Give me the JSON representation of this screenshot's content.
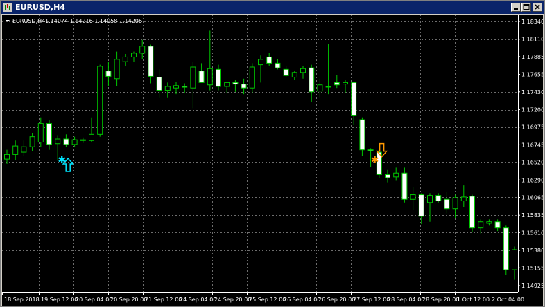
{
  "window": {
    "title": "EURUSD,H4"
  },
  "chart_header": {
    "symbol": "EURUSD,H4",
    "ohlc": "1.14074 1.14216 1.14058 1.14206"
  },
  "chart_data": {
    "type": "candlestick",
    "symbol": "EURUSD",
    "timeframe": "H4",
    "y_ticks": [
      "1.18340",
      "1.18110",
      "1.17885",
      "1.17655",
      "1.17430",
      "1.17200",
      "1.16975",
      "1.16745",
      "1.16520",
      "1.16290",
      "1.16065",
      "1.15835",
      "1.15610",
      "1.15380",
      "1.15155",
      "1.14925"
    ],
    "x_ticks": [
      "18 Sep 2018",
      "19 Sep 12:00",
      "20 Sep 04:00",
      "20 Sep 20:00",
      "21 Sep 12:00",
      "24 Sep 04:00",
      "24 Sep 20:00",
      "25 Sep 12:00",
      "26 Sep 04:00",
      "26 Sep 20:00",
      "27 Sep 12:00",
      "28 Sep 04:00",
      "28 Sep 20:00",
      "1 Oct 12:00",
      "2 Oct 04:00"
    ],
    "ylim": [
      1.14925,
      1.1839
    ],
    "grid": true,
    "colors": {
      "background": "#000000",
      "bull": "#000000",
      "bear": "#ffffff",
      "wick": "#00c800",
      "grid": "#c8c8c8",
      "axis_text": "#ffffff",
      "buy_marker": "#00e5ff",
      "sell_marker": "#ff9900"
    },
    "candles": [
      {
        "o": 1.1656,
        "h": 1.1668,
        "l": 1.165,
        "c": 1.1662
      },
      {
        "o": 1.1662,
        "h": 1.168,
        "l": 1.1655,
        "c": 1.1673
      },
      {
        "o": 1.1665,
        "h": 1.168,
        "l": 1.166,
        "c": 1.1672
      },
      {
        "o": 1.1672,
        "h": 1.169,
        "l": 1.1666,
        "c": 1.1685
      },
      {
        "o": 1.1678,
        "h": 1.171,
        "l": 1.1672,
        "c": 1.1702
      },
      {
        "o": 1.1702,
        "h": 1.1706,
        "l": 1.1668,
        "c": 1.1675
      },
      {
        "o": 1.1676,
        "h": 1.1687,
        "l": 1.1654,
        "c": 1.1682
      },
      {
        "o": 1.1682,
        "h": 1.1688,
        "l": 1.1672,
        "c": 1.1675
      },
      {
        "o": 1.1675,
        "h": 1.1685,
        "l": 1.1672,
        "c": 1.1681
      },
      {
        "o": 1.168,
        "h": 1.1684,
        "l": 1.1677,
        "c": 1.1681
      },
      {
        "o": 1.168,
        "h": 1.171,
        "l": 1.1678,
        "c": 1.1688
      },
      {
        "o": 1.1688,
        "h": 1.1778,
        "l": 1.1685,
        "c": 1.1776
      },
      {
        "o": 1.177,
        "h": 1.1782,
        "l": 1.175,
        "c": 1.1763
      },
      {
        "o": 1.176,
        "h": 1.1795,
        "l": 1.175,
        "c": 1.1785
      },
      {
        "o": 1.1782,
        "h": 1.1792,
        "l": 1.1776,
        "c": 1.1788
      },
      {
        "o": 1.1788,
        "h": 1.1795,
        "l": 1.1782,
        "c": 1.1793
      },
      {
        "o": 1.1793,
        "h": 1.181,
        "l": 1.1785,
        "c": 1.1802
      },
      {
        "o": 1.1802,
        "h": 1.1804,
        "l": 1.1754,
        "c": 1.1763
      },
      {
        "o": 1.1762,
        "h": 1.1772,
        "l": 1.1735,
        "c": 1.1745
      },
      {
        "o": 1.1745,
        "h": 1.1755,
        "l": 1.1735,
        "c": 1.175
      },
      {
        "o": 1.1748,
        "h": 1.1756,
        "l": 1.174,
        "c": 1.1751
      },
      {
        "o": 1.175,
        "h": 1.1754,
        "l": 1.1742,
        "c": 1.1749
      },
      {
        "o": 1.1748,
        "h": 1.1782,
        "l": 1.1722,
        "c": 1.1775
      },
      {
        "o": 1.177,
        "h": 1.178,
        "l": 1.1755,
        "c": 1.1755
      },
      {
        "o": 1.1752,
        "h": 1.1822,
        "l": 1.1745,
        "c": 1.1773
      },
      {
        "o": 1.1772,
        "h": 1.1778,
        "l": 1.1745,
        "c": 1.175
      },
      {
        "o": 1.175,
        "h": 1.1756,
        "l": 1.1742,
        "c": 1.1755
      },
      {
        "o": 1.1755,
        "h": 1.1758,
        "l": 1.1743,
        "c": 1.1753
      },
      {
        "o": 1.1753,
        "h": 1.176,
        "l": 1.174,
        "c": 1.1748
      },
      {
        "o": 1.1748,
        "h": 1.178,
        "l": 1.1742,
        "c": 1.1775
      },
      {
        "o": 1.1778,
        "h": 1.179,
        "l": 1.1755,
        "c": 1.1785
      },
      {
        "o": 1.1788,
        "h": 1.1793,
        "l": 1.1776,
        "c": 1.178
      },
      {
        "o": 1.178,
        "h": 1.1785,
        "l": 1.1772,
        "c": 1.1774
      },
      {
        "o": 1.1772,
        "h": 1.1776,
        "l": 1.1762,
        "c": 1.1764
      },
      {
        "o": 1.1762,
        "h": 1.177,
        "l": 1.1758,
        "c": 1.1768
      },
      {
        "o": 1.1768,
        "h": 1.1776,
        "l": 1.176,
        "c": 1.1773
      },
      {
        "o": 1.1774,
        "h": 1.1778,
        "l": 1.173,
        "c": 1.1743
      },
      {
        "o": 1.1744,
        "h": 1.176,
        "l": 1.1735,
        "c": 1.1752
      },
      {
        "o": 1.175,
        "h": 1.1805,
        "l": 1.174,
        "c": 1.175
      },
      {
        "o": 1.1755,
        "h": 1.1765,
        "l": 1.1748,
        "c": 1.1752
      },
      {
        "o": 1.1753,
        "h": 1.1758,
        "l": 1.1742,
        "c": 1.1755
      },
      {
        "o": 1.1755,
        "h": 1.1755,
        "l": 1.17,
        "c": 1.1712
      },
      {
        "o": 1.1707,
        "h": 1.171,
        "l": 1.166,
        "c": 1.1668
      },
      {
        "o": 1.1668,
        "h": 1.167,
        "l": 1.1646,
        "c": 1.1667
      },
      {
        "o": 1.1665,
        "h": 1.167,
        "l": 1.1632,
        "c": 1.1636
      },
      {
        "o": 1.1636,
        "h": 1.1642,
        "l": 1.1626,
        "c": 1.1632
      },
      {
        "o": 1.1633,
        "h": 1.1645,
        "l": 1.1628,
        "c": 1.1638
      },
      {
        "o": 1.1638,
        "h": 1.1645,
        "l": 1.16,
        "c": 1.1604
      },
      {
        "o": 1.1604,
        "h": 1.162,
        "l": 1.159,
        "c": 1.161
      },
      {
        "o": 1.161,
        "h": 1.1612,
        "l": 1.1572,
        "c": 1.1582
      },
      {
        "o": 1.16,
        "h": 1.1612,
        "l": 1.1575,
        "c": 1.1609
      },
      {
        "o": 1.1609,
        "h": 1.1612,
        "l": 1.16,
        "c": 1.1602
      },
      {
        "o": 1.1604,
        "h": 1.1614,
        "l": 1.1586,
        "c": 1.1592
      },
      {
        "o": 1.1592,
        "h": 1.161,
        "l": 1.158,
        "c": 1.1606
      },
      {
        "o": 1.1602,
        "h": 1.1622,
        "l": 1.1594,
        "c": 1.1607
      },
      {
        "o": 1.1608,
        "h": 1.161,
        "l": 1.1562,
        "c": 1.1567
      },
      {
        "o": 1.1567,
        "h": 1.1578,
        "l": 1.156,
        "c": 1.1575
      },
      {
        "o": 1.1573,
        "h": 1.1578,
        "l": 1.157,
        "c": 1.1575
      },
      {
        "o": 1.1575,
        "h": 1.1578,
        "l": 1.1563,
        "c": 1.1567
      },
      {
        "o": 1.1567,
        "h": 1.157,
        "l": 1.1506,
        "c": 1.1513
      },
      {
        "o": 1.1513,
        "h": 1.1543,
        "l": 1.15,
        "c": 1.1539
      }
    ],
    "markers": [
      {
        "type": "buy-arrow",
        "index": 6,
        "price": 1.1648
      },
      {
        "type": "buy-star",
        "index": 6,
        "price": 1.1656
      },
      {
        "type": "sell-arrow",
        "index": 43,
        "price": 1.1668
      },
      {
        "type": "sell-star",
        "index": 43,
        "price": 1.1656
      }
    ]
  }
}
